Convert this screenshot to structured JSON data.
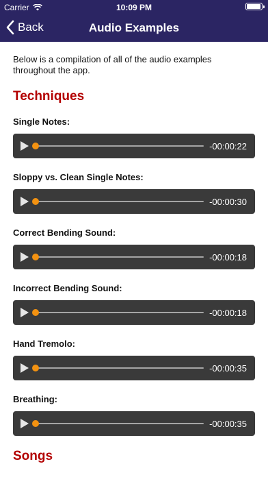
{
  "status_bar": {
    "carrier": "Carrier",
    "time": "10:09 PM"
  },
  "nav": {
    "back_label": "Back",
    "title": "Audio Examples"
  },
  "intro": "Below is a compilation of all of the audio examples throughout the app.",
  "sections": [
    {
      "title": "Techniques",
      "items": [
        {
          "label": "Single Notes:",
          "remaining": "-00:00:22",
          "progress": 0.0
        },
        {
          "label": "Sloppy vs. Clean Single Notes:",
          "remaining": "-00:00:30",
          "progress": 0.0
        },
        {
          "label": "Correct Bending Sound:",
          "remaining": "-00:00:18",
          "progress": 0.0
        },
        {
          "label": "Incorrect Bending Sound:",
          "remaining": "-00:00:18",
          "progress": 0.0
        },
        {
          "label": "Hand Tremolo:",
          "remaining": "-00:00:35",
          "progress": 0.0
        },
        {
          "label": "Breathing:",
          "remaining": "-00:00:35",
          "progress": 0.0
        }
      ]
    },
    {
      "title": "Songs"
    }
  ],
  "colors": {
    "navbar_bg": "#2b2563",
    "section_title": "#b30000",
    "player_bg": "#3a3a3a",
    "thumb": "#f39211"
  },
  "icons": {
    "back": "chevron-left-icon",
    "play": "play-icon",
    "wifi": "wifi-icon",
    "battery": "battery-icon"
  }
}
